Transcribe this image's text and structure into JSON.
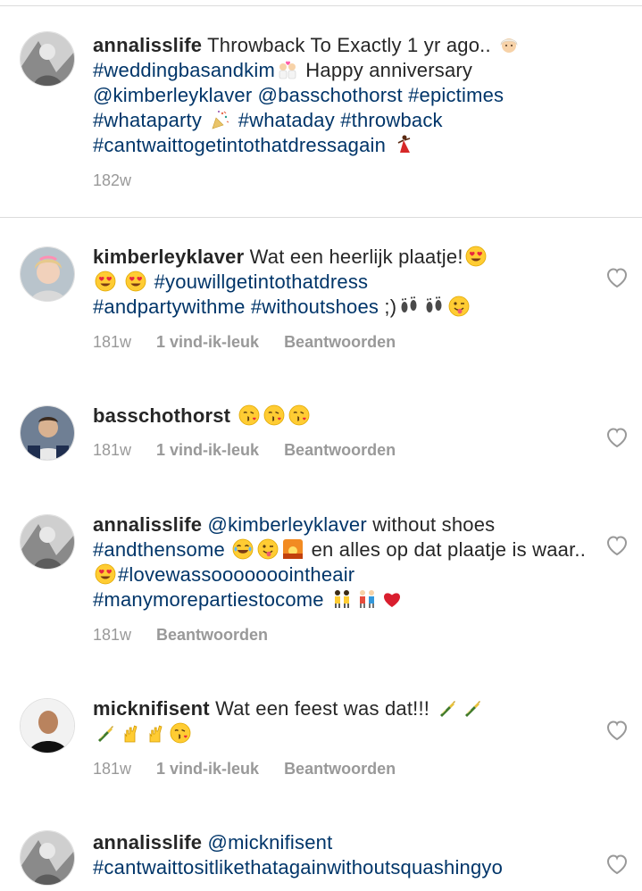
{
  "caption": {
    "username": "annalisslife",
    "text1": "Throwback To Exactly 1 yr ago..",
    "tag_wedding": "#weddingbasandkim",
    "text2": "Happy anniversary",
    "mention1": "@kimberleyklaver",
    "mention2": "@basschothorst",
    "tag_epic": "#epictimes",
    "tag_party": "#whataparty",
    "tag_day": "#whataday",
    "tag_throwback": "#throwback",
    "tag_dress": "#cantwaittogetintothatdressagain",
    "time": "182w"
  },
  "comments": [
    {
      "username": "kimberleyklaver",
      "text1": "Wat een heerlijk plaatje!",
      "tag1": "#youwillgetintothatdress",
      "tag2": "#andpartywithme",
      "tag3": "#withoutshoes",
      "text2": ";)",
      "time": "181w",
      "likes": "1 vind-ik-leuk",
      "reply": "Beantwoorden"
    },
    {
      "username": "basschothorst",
      "time": "181w",
      "likes": "1 vind-ik-leuk",
      "reply": "Beantwoorden"
    },
    {
      "username": "annalisslife",
      "mention": "@kimberleyklaver",
      "text1": "without shoes",
      "tag1": "#andthensome",
      "text2": "en alles op dat plaatje is waar..",
      "tag2": "#lovewassooooooointheair",
      "tag3": "#manymorepartiestocome",
      "time": "181w",
      "reply": "Beantwoorden"
    },
    {
      "username": "micknifisent",
      "text1": "Wat een feest was dat!!!",
      "time": "181w",
      "likes": "1 vind-ik-leuk",
      "reply": "Beantwoorden"
    },
    {
      "username": "annalisslife",
      "mention": "@micknifisent",
      "tag1": "#cantwaittositlikethatagainwithoutsquashingyo"
    }
  ],
  "icons": {
    "heart": "heart-outline-icon",
    "heart_color": "#999999",
    "link_color": "#003569"
  }
}
